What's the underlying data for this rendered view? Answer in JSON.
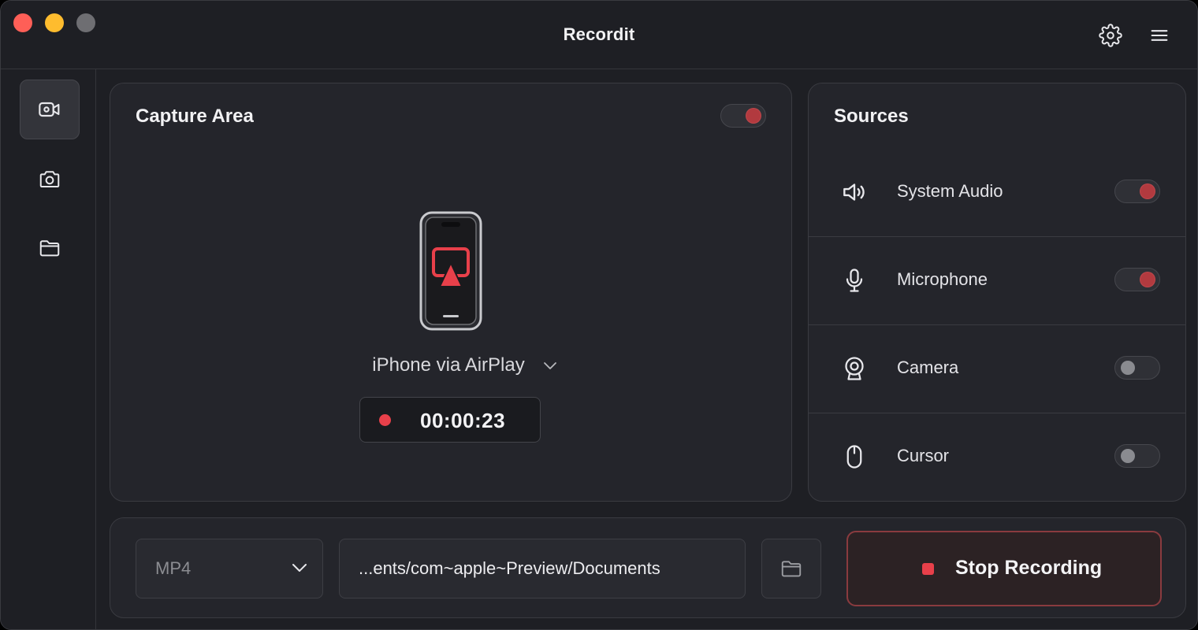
{
  "window": {
    "title": "Recordit"
  },
  "titlebar": {
    "icons": [
      "gear-icon",
      "hamburger-menu-icon"
    ]
  },
  "sidebar": {
    "items": [
      {
        "icon": "video-camera-icon",
        "active": true
      },
      {
        "icon": "camera-icon",
        "active": false
      },
      {
        "icon": "folder-icon",
        "active": false
      }
    ]
  },
  "capture": {
    "title": "Capture Area",
    "enabled": true,
    "device_label": "iPhone via AirPlay",
    "timer": "00:00:23"
  },
  "sources": {
    "title": "Sources",
    "items": [
      {
        "label": "System Audio",
        "icon": "speaker-icon",
        "enabled": true
      },
      {
        "label": "Microphone",
        "icon": "microphone-icon",
        "enabled": true
      },
      {
        "label": "Camera",
        "icon": "webcam-icon",
        "enabled": false
      },
      {
        "label": "Cursor",
        "icon": "mouse-icon",
        "enabled": false
      }
    ]
  },
  "output": {
    "format": "MP4",
    "path": "...ents/com~apple~Preview/Documents",
    "stop_label": "Stop Recording"
  },
  "colors": {
    "accent_red": "#e8404a",
    "toggle_on_knob": "#b23a3f",
    "background": "#1e1f24",
    "panel": "#24252b"
  }
}
